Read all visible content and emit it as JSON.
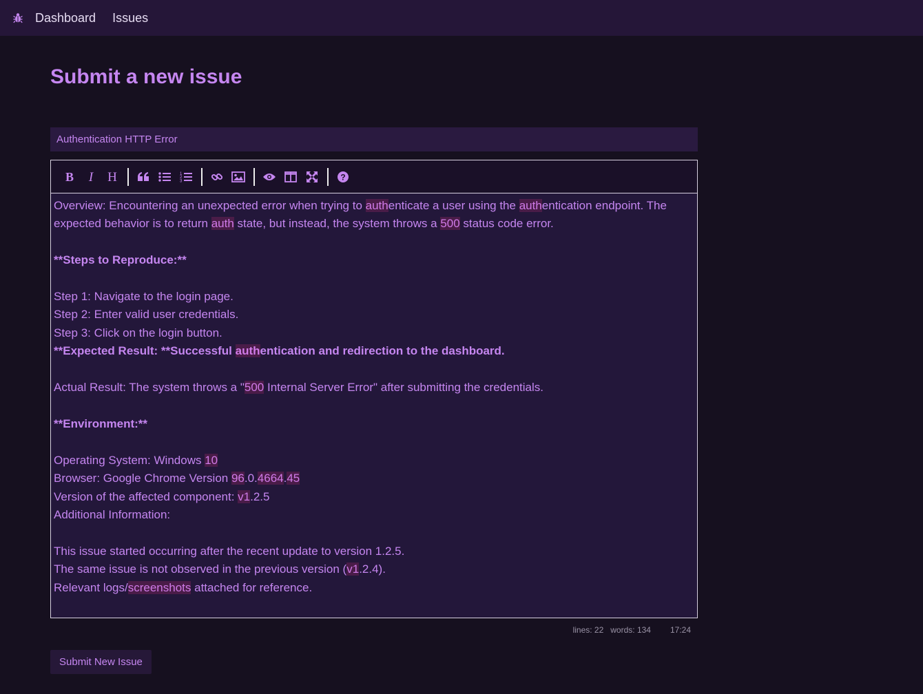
{
  "nav": {
    "logo_icon": "bug-icon",
    "links": [
      "Dashboard",
      "Issues"
    ]
  },
  "page": {
    "title": "Submit a new issue"
  },
  "form": {
    "title_value": "Authentication HTTP Error",
    "toolbar": [
      "bold",
      "italic",
      "heading",
      "quote",
      "unordered-list",
      "ordered-list",
      "link",
      "image",
      "preview",
      "side-by-side",
      "fullscreen",
      "guide"
    ],
    "body_lines": [
      {
        "text": "Overview: Encountering an unexpected error when trying to authenticate a user using the authentication endpoint. The expected behavior is to return auth state, but instead, the system throws a 500 status code error.",
        "bold": false
      },
      {
        "text": "",
        "bold": false
      },
      {
        "text": "**Steps to Reproduce:**",
        "bold": true
      },
      {
        "text": "",
        "bold": false
      },
      {
        "text": "Step 1: Navigate to the login page.",
        "bold": false
      },
      {
        "text": "Step 2: Enter valid user credentials.",
        "bold": false
      },
      {
        "text": "Step 3: Click on the login button.",
        "bold": false
      },
      {
        "text": "**Expected Result: **Successful authentication and redirection to the dashboard.",
        "bold": true
      },
      {
        "text": "",
        "bold": false
      },
      {
        "text": "Actual Result: The system throws a \"500 Internal Server Error\" after submitting the credentials.",
        "bold": false
      },
      {
        "text": "",
        "bold": false
      },
      {
        "text": "**Environment:**",
        "bold": true
      },
      {
        "text": "",
        "bold": false
      },
      {
        "text": "Operating System: Windows 10",
        "bold": false
      },
      {
        "text": "Browser: Google Chrome Version 96.0.4664.45",
        "bold": false
      },
      {
        "text": "Version of the affected component: v1.2.5",
        "bold": false
      },
      {
        "text": "Additional Information:",
        "bold": false
      },
      {
        "text": "",
        "bold": false
      },
      {
        "text": "This issue started occurring after the recent update to version 1.2.5.",
        "bold": false
      },
      {
        "text": "The same issue is not observed in the previous version (v1.2.4).",
        "bold": false
      },
      {
        "text": "Relevant logs/screenshots attached for reference.",
        "bold": false
      }
    ],
    "highlights": [
      "auth",
      "500",
      "10",
      "96",
      "4664",
      "45",
      "v1",
      "screenshots"
    ],
    "status": {
      "lines": "lines: 22",
      "words": "words: 134",
      "cursor": "17:24"
    },
    "submit_label": "Submit New Issue"
  },
  "colors": {
    "accent": "#c586f0",
    "background": "#16101f",
    "nav_bg": "#251638"
  }
}
